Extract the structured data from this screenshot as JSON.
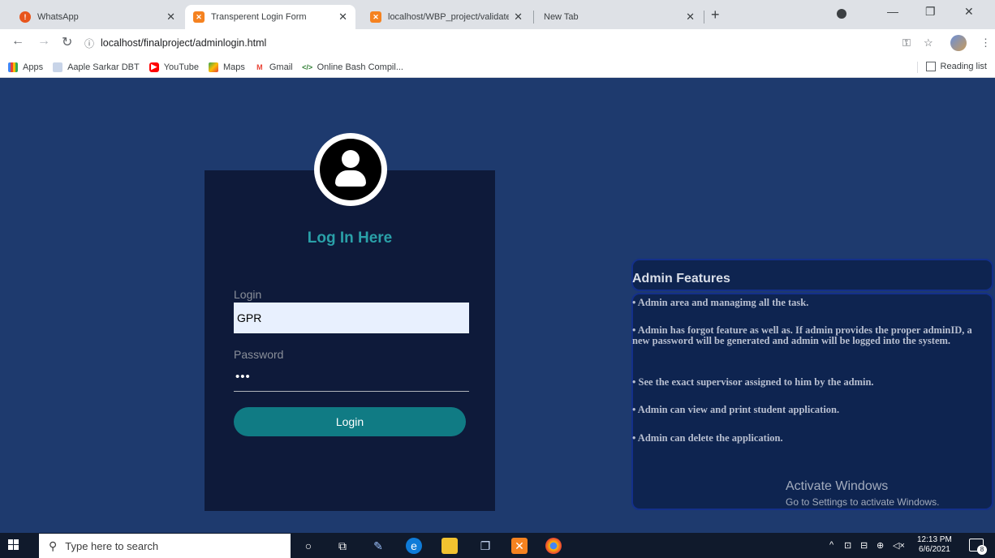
{
  "browser": {
    "tabs": [
      {
        "label": "WhatsApp",
        "icon": "whatsapp-icon"
      },
      {
        "label": "Transperent Login Form",
        "icon": "xampp-icon"
      },
      {
        "label": "localhost/WBP_project/validate.p",
        "icon": "xampp-icon"
      },
      {
        "label": "New Tab",
        "icon": ""
      }
    ],
    "url": "localhost/finalproject/adminlogin.html",
    "bookmarks": [
      {
        "label": "Apps",
        "icon": "apps-grid-icon"
      },
      {
        "label": "Aaple Sarkar DBT",
        "icon": "document-icon"
      },
      {
        "label": "YouTube",
        "icon": "youtube-icon"
      },
      {
        "label": "Maps",
        "icon": "maps-icon"
      },
      {
        "label": "Gmail",
        "icon": "gmail-icon"
      },
      {
        "label": "Online Bash Compil...",
        "icon": "code-icon"
      }
    ],
    "reading_list": "Reading list"
  },
  "login": {
    "title": "Log In Here",
    "login_label": "Login",
    "login_value": "GPR",
    "password_label": "Password",
    "password_value": "•••",
    "button_label": "Login"
  },
  "features": {
    "title": "Admin Features",
    "items": [
      "• Admin area and managimg all the task.",
      "• Admin has forgot feature as well as. If admin provides the proper adminID, a new password will be generated and admin will be logged into the system.",
      "• See the exact supervisor assigned to him by the admin.",
      "• Admin can view and print student application.",
      "• Admin can delete the application."
    ]
  },
  "watermark": {
    "line1": "Activate Windows",
    "line2": "Go to Settings to activate Windows."
  },
  "taskbar": {
    "search_placeholder": "Type here to search",
    "time": "12:13 PM",
    "date": "6/6/2021",
    "notification_count": "8"
  },
  "colors": {
    "page_bg": "#1e3a6e",
    "login_panel": "#0e1a3a",
    "accent_teal": "#2aa0a8",
    "button_teal": "#107b84"
  }
}
